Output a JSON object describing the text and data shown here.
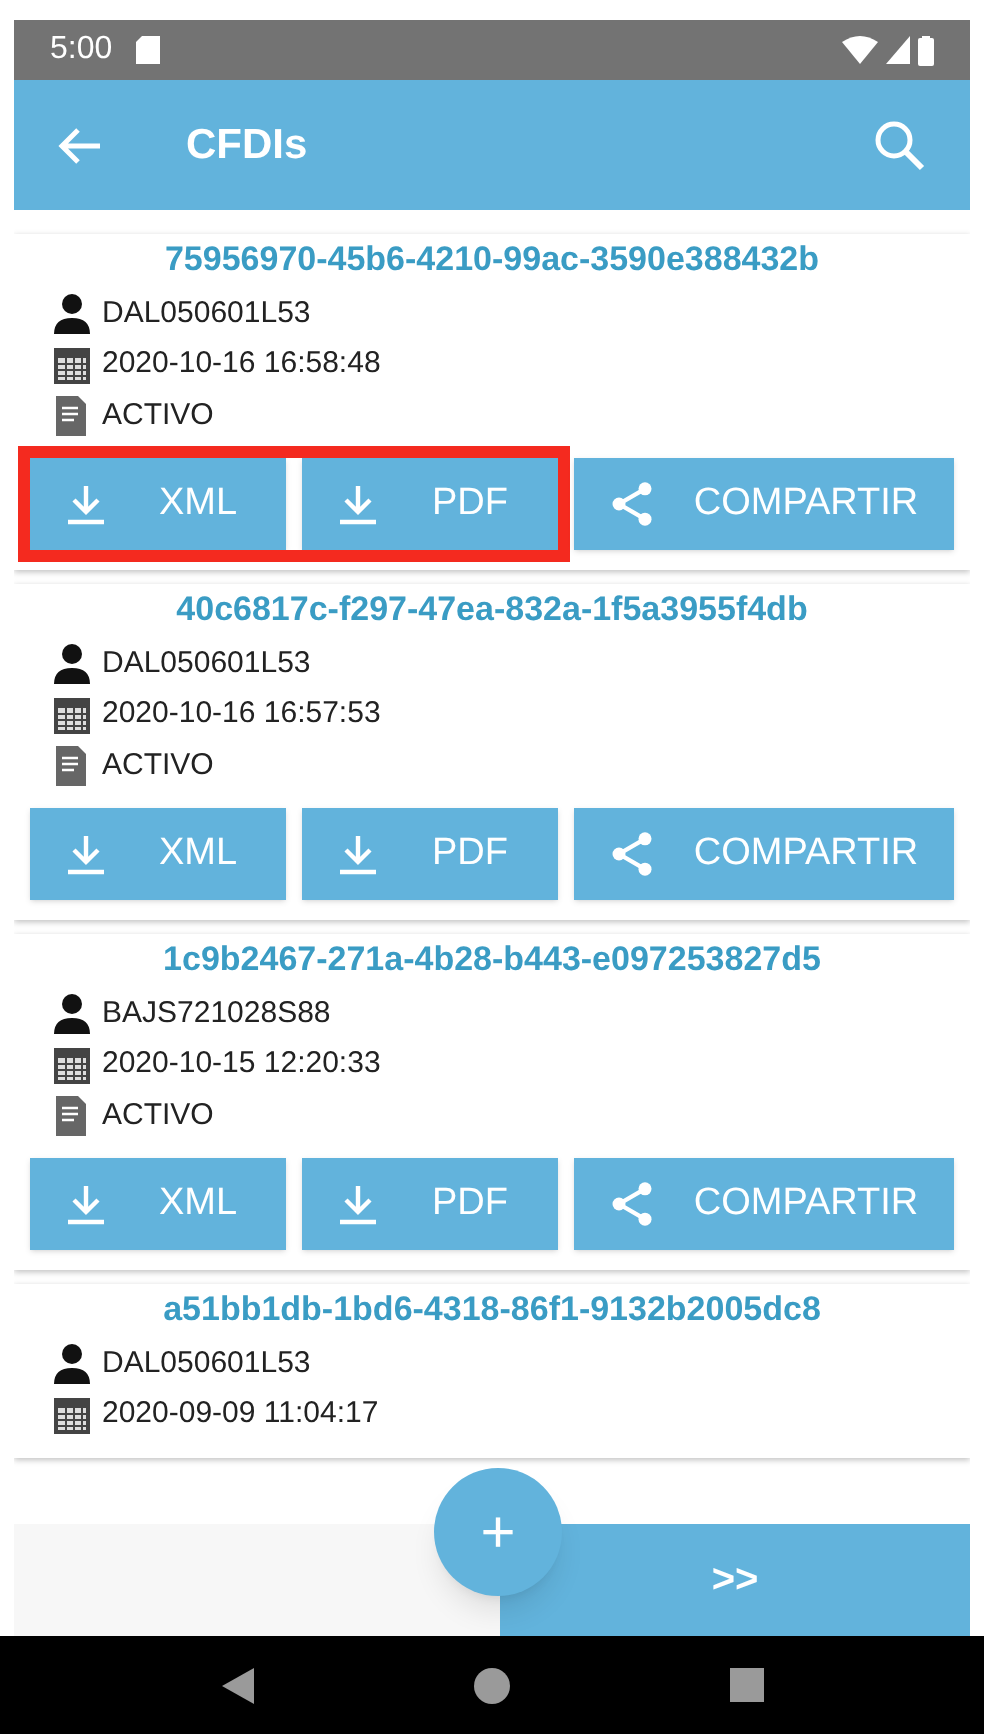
{
  "status_bar": {
    "time": "5:00"
  },
  "app_bar": {
    "title": "CFDIs"
  },
  "cards": [
    {
      "uuid": "75956970-45b6-4210-99ac-3590e388432b",
      "rfc": "DAL050601L53",
      "date": "2020-10-16 16:58:48",
      "status": "ACTIVO",
      "highlighted": true,
      "buttons": [
        {
          "kind": "download",
          "label": "XML"
        },
        {
          "kind": "download",
          "label": "PDF"
        },
        {
          "kind": "share",
          "label": "COMPARTIR"
        }
      ]
    },
    {
      "uuid": "40c6817c-f297-47ea-832a-1f5a3955f4db",
      "rfc": "DAL050601L53",
      "date": "2020-10-16 16:57:53",
      "status": "ACTIVO",
      "buttons": [
        {
          "kind": "download",
          "label": "XML"
        },
        {
          "kind": "download",
          "label": "PDF"
        },
        {
          "kind": "share",
          "label": "COMPARTIR"
        }
      ]
    },
    {
      "uuid": "1c9b2467-271a-4b28-b443-e097253827d5",
      "rfc": "BAJS721028S88",
      "date": "2020-10-15 12:20:33",
      "status": "ACTIVO",
      "buttons": [
        {
          "kind": "download",
          "label": "XML"
        },
        {
          "kind": "download",
          "label": "PDF"
        },
        {
          "kind": "share",
          "label": "COMPARTIR"
        }
      ]
    },
    {
      "uuid": "a51bb1db-1bd6-4318-86f1-9132b2005dc8",
      "rfc": "DAL050601L53",
      "date": "2020-09-09 11:04:17"
    }
  ],
  "next_button": {
    "label": ">>"
  },
  "fab": {
    "label": "+"
  }
}
